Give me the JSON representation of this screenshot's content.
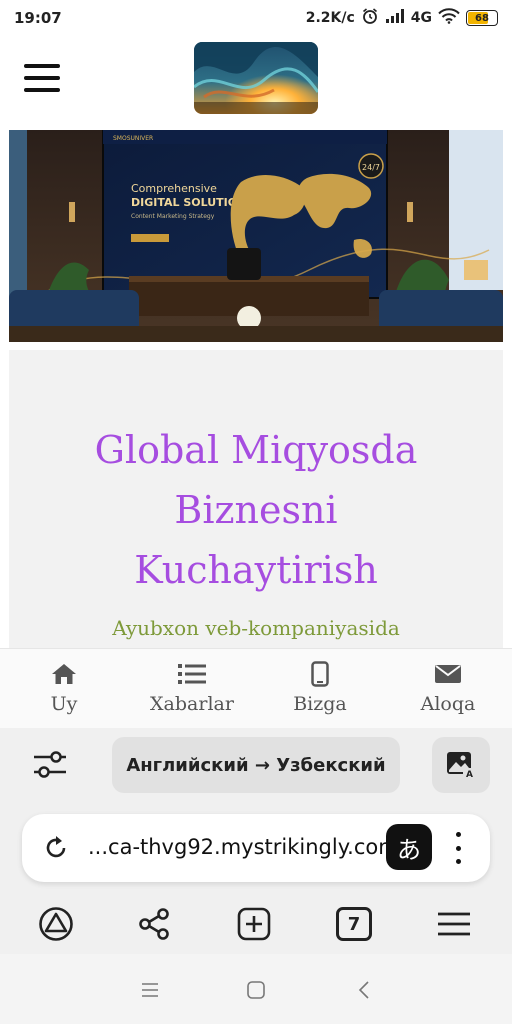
{
  "status_bar": {
    "time": "19:07",
    "net_speed": "2.2K/c",
    "network": "4G",
    "battery": "68",
    "battery_level": 0.68
  },
  "site": {
    "logo_icon": "abstract-logo-image",
    "hero_icon": "office-world-map-image",
    "hero_texts": {
      "brand": "SMOSUNIVER",
      "line1": "Comprehensive",
      "line2": "DIGITAL SOLUTIONS",
      "line3": "Content Marketing Strategy",
      "badge": "24/7"
    },
    "headline_lines": [
      "Global Miqyosda",
      "Biznesni",
      "Kuchaytirish"
    ],
    "subline": "Ayubxon veb-kompaniyasida",
    "nav": [
      {
        "label": "Uy",
        "icon": "home-icon"
      },
      {
        "label": "Xabarlar",
        "icon": "list-icon"
      },
      {
        "label": "Bizga",
        "icon": "phone-icon"
      },
      {
        "label": "Aloqa",
        "icon": "mail-icon"
      }
    ],
    "colors": {
      "headline": "#a64de0",
      "subline": "#7e9a3a"
    }
  },
  "translate_bar": {
    "language_pair": "Английский → Узбекский"
  },
  "address_bar": {
    "url": "...ca-thvg92.mystrikingly.com",
    "translate_glyph": "あ"
  },
  "browser_toolbar": {
    "tabs_count": "7"
  }
}
